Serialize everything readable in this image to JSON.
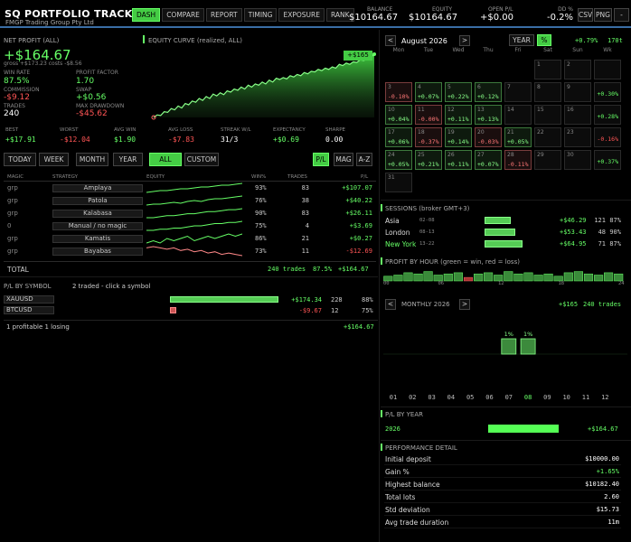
{
  "app": {
    "title": "SQ  PORTFOLIO TRACKER",
    "company": "FMGP Trading Group Pty Ltd"
  },
  "nav": [
    "DASH",
    "COMPARE",
    "REPORT",
    "TIMING",
    "EXPOSURE",
    "RANK"
  ],
  "header": {
    "balance_label": "BALANCE",
    "balance": "$10164.67",
    "equity_label": "EQUITY",
    "equity": "$10164.67",
    "openpl_label": "OPEN P/L",
    "openpl": "+$0.00",
    "dd_label": "DD %",
    "dd": "-0.2%",
    "csv": "CSV",
    "png": "PNG",
    "dash": "-"
  },
  "profit": {
    "label": "NET PROFIT (ALL)",
    "value": "+$164.67",
    "gross": "gross +$173.23  costs  -$8.56",
    "winrate_l": "WIN RATE",
    "winrate": "87.5%",
    "pf_l": "PROFIT FACTOR",
    "pf": "1.70",
    "comm_l": "COMMISSION",
    "comm": "-$9.12",
    "swap_l": "SWAP",
    "swap": "+$0.56",
    "trades_l": "TRADES",
    "trades": "240",
    "mdd_l": "MAX DRAWDOWN",
    "mdd": "-$45.62"
  },
  "curve": {
    "label": "EQUITY CURVE  (realized, ALL)",
    "end": "+$165",
    "points": [
      0,
      4,
      3,
      9,
      8,
      14,
      12,
      18,
      15,
      22,
      20,
      26,
      24,
      30,
      27,
      33,
      30,
      37,
      34,
      39,
      36,
      42,
      40,
      45,
      43,
      48,
      45,
      51,
      48,
      53,
      51,
      56,
      53,
      59,
      56,
      62,
      60,
      63,
      61,
      66,
      64,
      68,
      66,
      71,
      69,
      73,
      72,
      76,
      74,
      78,
      76,
      80,
      78,
      84,
      82,
      86,
      84,
      88,
      87,
      91,
      90,
      93,
      95,
      100
    ]
  },
  "summary": [
    {
      "l": "BEST",
      "v": "+$17.91",
      "c": "g"
    },
    {
      "l": "WORST",
      "v": "-$12.04",
      "c": "r"
    },
    {
      "l": "AVG WIN",
      "v": "$1.90",
      "c": "g"
    },
    {
      "l": "AVG LOSS",
      "v": "-$7.83",
      "c": "r"
    },
    {
      "l": "STREAK W/L",
      "v": "31/3",
      "c": "w"
    },
    {
      "l": "EXPECTANCY",
      "v": "+$0.69",
      "c": "g"
    },
    {
      "l": "SHARPE",
      "v": "0.00",
      "c": "w"
    }
  ],
  "periods": [
    "TODAY",
    "WEEK",
    "MONTH",
    "YEAR",
    "ALL",
    "CUSTOM"
  ],
  "modes": [
    "P/L",
    "MAG",
    "A-Z"
  ],
  "table": {
    "headers": [
      "MAGIC",
      "STRATEGY",
      "EQUITY",
      "WIN%",
      "TRADES",
      "P/L"
    ],
    "rows": [
      {
        "magic": "grp",
        "strategy": "Amplaya",
        "win": "93%",
        "trades": "83",
        "pl": "+$107.07",
        "c": "g",
        "spark": [
          2,
          3,
          4,
          4,
          5,
          6,
          6,
          7,
          8,
          8,
          9,
          10,
          10,
          11,
          12
        ]
      },
      {
        "magic": "grp",
        "strategy": "Patola",
        "win": "76%",
        "trades": "38",
        "pl": "+$40.22",
        "c": "g",
        "spark": [
          2,
          3,
          3,
          4,
          5,
          4,
          6,
          7,
          6,
          8,
          9,
          9,
          10,
          11,
          12
        ]
      },
      {
        "magic": "grp",
        "strategy": "Kalabasa",
        "win": "90%",
        "trades": "83",
        "pl": "+$26.11",
        "c": "g",
        "spark": [
          3,
          3,
          4,
          5,
          5,
          6,
          7,
          7,
          8,
          9,
          9,
          10,
          11,
          11,
          12
        ]
      },
      {
        "magic": "0",
        "strategy": "Manual / no magic",
        "win": "75%",
        "trades": "4",
        "pl": "+$3.69",
        "c": "g",
        "spark": [
          2,
          2,
          3,
          3,
          4,
          4,
          5,
          6,
          6,
          7,
          8,
          8,
          9,
          9,
          10
        ]
      },
      {
        "magic": "grp",
        "strategy": "Kamatis",
        "win": "86%",
        "trades": "21",
        "pl": "+$0.27",
        "c": "g",
        "spark": [
          5,
          6,
          5,
          7,
          6,
          7,
          8,
          6,
          7,
          8,
          7,
          8,
          9,
          8,
          9
        ]
      },
      {
        "magic": "grp",
        "strategy": "Bayabas",
        "win": "73%",
        "trades": "11",
        "pl": "-$12.69",
        "c": "r",
        "spark": [
          8,
          9,
          8,
          7,
          8,
          6,
          7,
          5,
          6,
          4,
          5,
          3,
          4,
          3,
          2
        ]
      }
    ],
    "total_label": "TOTAL",
    "total_trades": "240 trades",
    "total_win": "87.5%",
    "total_pl": "+$164.67"
  },
  "bysymbol": {
    "label": "P/L BY SYMBOL",
    "traded": "2 traded  -  click a symbol",
    "rows": [
      {
        "sym": "XAUUSD",
        "pl": "+$174.34",
        "trades": "228",
        "win": "88%",
        "c": "g",
        "frac": 1.0
      },
      {
        "sym": "BTCUSD",
        "pl": "-$9.67",
        "trades": "12",
        "win": "75%",
        "c": "r",
        "frac": 0.06
      }
    ],
    "footer": "1 profitable  1 losing",
    "footer_pl": "+$164.67"
  },
  "calendar": {
    "month": "August 2026",
    "prev": "<",
    "next": ">",
    "year_btn": "YEAR",
    "pct_btn": "%",
    "pct": "+0.79%",
    "trades": "170t",
    "days": [
      "Mon",
      "Tue",
      "Wed",
      "Thu",
      "Fri",
      "Sat",
      "Sun",
      "Wk"
    ],
    "cells": [
      {
        "col": 5,
        "row": 0,
        "d": "1",
        "p": "",
        "c": ""
      },
      {
        "col": 6,
        "row": 0,
        "d": "2",
        "p": "",
        "c": ""
      },
      {
        "col": 0,
        "row": 1,
        "d": "3",
        "p": "-0.10%",
        "c": "neg"
      },
      {
        "col": 1,
        "row": 1,
        "d": "4",
        "p": "+0.07%",
        "c": "pos"
      },
      {
        "col": 2,
        "row": 1,
        "d": "5",
        "p": "+0.22%",
        "c": "pos"
      },
      {
        "col": 3,
        "row": 1,
        "d": "6",
        "p": "+0.12%",
        "c": "pos"
      },
      {
        "col": 4,
        "row": 1,
        "d": "7",
        "p": "",
        "c": ""
      },
      {
        "col": 5,
        "row": 1,
        "d": "8",
        "p": "",
        "c": ""
      },
      {
        "col": 6,
        "row": 1,
        "d": "9",
        "p": "",
        "c": ""
      },
      {
        "col": 0,
        "row": 2,
        "d": "10",
        "p": "+0.04%",
        "c": "pos"
      },
      {
        "col": 1,
        "row": 2,
        "d": "11",
        "p": "-0.00%",
        "c": "neg"
      },
      {
        "col": 2,
        "row": 2,
        "d": "12",
        "p": "+0.11%",
        "c": "pos"
      },
      {
        "col": 3,
        "row": 2,
        "d": "13",
        "p": "+0.13%",
        "c": "pos"
      },
      {
        "col": 4,
        "row": 2,
        "d": "14",
        "p": "",
        "c": ""
      },
      {
        "col": 5,
        "row": 2,
        "d": "15",
        "p": "",
        "c": ""
      },
      {
        "col": 6,
        "row": 2,
        "d": "16",
        "p": "",
        "c": ""
      },
      {
        "col": 0,
        "row": 3,
        "d": "17",
        "p": "+0.06%",
        "c": "pos"
      },
      {
        "col": 1,
        "row": 3,
        "d": "18",
        "p": "-0.37%",
        "c": "neg"
      },
      {
        "col": 2,
        "row": 3,
        "d": "19",
        "p": "+0.14%",
        "c": "pos"
      },
      {
        "col": 3,
        "row": 3,
        "d": "20",
        "p": "-0.03%",
        "c": "neg"
      },
      {
        "col": 4,
        "row": 3,
        "d": "21",
        "p": "+0.05%",
        "c": "pos"
      },
      {
        "col": 5,
        "row": 3,
        "d": "22",
        "p": "",
        "c": ""
      },
      {
        "col": 6,
        "row": 3,
        "d": "23",
        "p": "",
        "c": ""
      },
      {
        "col": 0,
        "row": 4,
        "d": "24",
        "p": "+0.05%",
        "c": "pos"
      },
      {
        "col": 1,
        "row": 4,
        "d": "25",
        "p": "+0.21%",
        "c": "pos"
      },
      {
        "col": 2,
        "row": 4,
        "d": "26",
        "p": "+0.11%",
        "c": "pos"
      },
      {
        "col": 3,
        "row": 4,
        "d": "27",
        "p": "+0.07%",
        "c": "pos"
      },
      {
        "col": 4,
        "row": 4,
        "d": "28",
        "p": "-0.11%",
        "c": "neg"
      },
      {
        "col": 5,
        "row": 4,
        "d": "29",
        "p": "",
        "c": ""
      },
      {
        "col": 6,
        "row": 4,
        "d": "30",
        "p": "",
        "c": ""
      },
      {
        "col": 0,
        "row": 5,
        "d": "31",
        "p": "",
        "c": ""
      }
    ],
    "weeks": [
      {
        "row": 0,
        "p": "",
        "c": ""
      },
      {
        "row": 1,
        "p": "+0.30%",
        "c": "g"
      },
      {
        "row": 2,
        "p": "+0.28%",
        "c": "g"
      },
      {
        "row": 3,
        "p": "-0.16%",
        "c": "r"
      },
      {
        "row": 4,
        "p": "+0.37%",
        "c": "g"
      }
    ]
  },
  "sessions": {
    "label": "SESSIONS  (broker GMT+3)",
    "rows": [
      {
        "name": "Asia",
        "hours": "02-08",
        "pl": "+$46.29",
        "trades": "121",
        "win": "87%",
        "frac": 0.7,
        "hl": false
      },
      {
        "name": "London",
        "hours": "08-13",
        "pl": "+$53.43",
        "trades": "48",
        "win": "90%",
        "frac": 0.8,
        "hl": false
      },
      {
        "name": "New York",
        "hours": "13-22",
        "pl": "+$64.95",
        "trades": "71",
        "win": "87%",
        "frac": 1.0,
        "hl": true
      }
    ]
  },
  "hours": {
    "label": "PROFIT BY HOUR  (green = win, red = loss)",
    "ticks": [
      "00",
      "06",
      "12",
      "18",
      "24"
    ],
    "values": [
      0.4,
      0.5,
      0.7,
      0.6,
      0.8,
      0.5,
      0.6,
      0.7,
      -0.3,
      0.6,
      0.7,
      0.5,
      0.8,
      0.6,
      0.7,
      0.5,
      0.6,
      0.4,
      0.7,
      0.8,
      0.6,
      0.5,
      0.7,
      0.6
    ]
  },
  "monthly": {
    "label": "MONTHLY  2026",
    "pl": "+$165",
    "trades": "240 trades",
    "prev": "<",
    "next": ">",
    "months": [
      "01",
      "02",
      "03",
      "04",
      "05",
      "06",
      "07",
      "08",
      "09",
      "10",
      "11",
      "12"
    ],
    "values": [
      0,
      0,
      0,
      0,
      0,
      0,
      1,
      1,
      0,
      0,
      0,
      0
    ],
    "labels": [
      "",
      "",
      "",
      "",
      "",
      "",
      "1%",
      "1%",
      "",
      "",
      "",
      ""
    ]
  },
  "byyear": {
    "label": "P/L BY YEAR",
    "year": "2026",
    "pl": "+$164.67",
    "frac": 1.0
  },
  "perf": {
    "label": "PERFORMANCE DETAIL",
    "rows": [
      {
        "l": "Initial deposit",
        "v": "$10000.00",
        "c": "w"
      },
      {
        "l": "Gain %",
        "v": "+1.65%",
        "c": "g"
      },
      {
        "l": "Highest balance",
        "v": "$10182.40",
        "c": "w"
      },
      {
        "l": "Total lots",
        "v": "2.60",
        "c": "w"
      },
      {
        "l": "Std deviation",
        "v": "$15.73",
        "c": "w"
      },
      {
        "l": "Avg trade duration",
        "v": "11m",
        "c": "w"
      }
    ]
  },
  "colors": {
    "green": "#66ff66",
    "red": "#ff5555",
    "accent": "#3a6ea5"
  }
}
